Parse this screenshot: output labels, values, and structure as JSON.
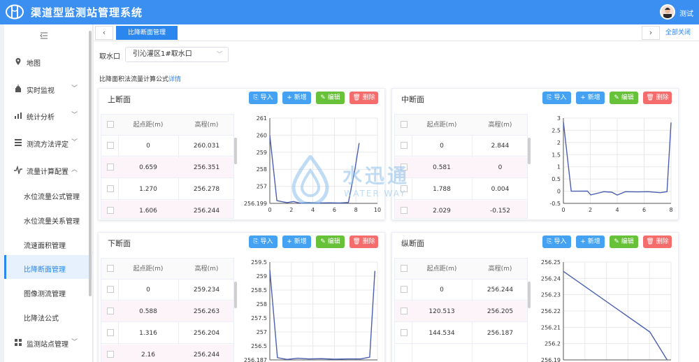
{
  "app": {
    "title": "渠道型监测站管理系统",
    "user": "测试"
  },
  "sidebar": {
    "items": [
      {
        "label": "地图",
        "icon": "map-pin-icon",
        "expandable": false
      },
      {
        "label": "实时监视",
        "icon": "alarm-icon",
        "expandable": true
      },
      {
        "label": "统计分析",
        "icon": "bar-chart-icon",
        "expandable": true
      },
      {
        "label": "测流方法评定",
        "icon": "list-icon",
        "expandable": true
      },
      {
        "label": "流量计算配置",
        "icon": "pulse-icon",
        "expandable": true,
        "expanded": true
      },
      {
        "label": "监测站点管理",
        "icon": "grid-icon",
        "expandable": true
      }
    ],
    "subitems": [
      "水位流量公式管理",
      "水位流量关系管理",
      "流速面积管理",
      "比降断面管理",
      "图像测流管理",
      "比降法公式"
    ],
    "active_sub": "比降断面管理"
  },
  "tabs": {
    "active": "比降断面管理",
    "close_all": "全部关闭",
    "prev": "‹",
    "next": "›"
  },
  "filter": {
    "label": "取水口",
    "value": "引沁灌区1#取水口"
  },
  "formula": {
    "text": "比降面积法流量计算公式",
    "link": "详情"
  },
  "buttons": {
    "import": "导入",
    "add": "新增",
    "edit": "编辑",
    "delete": "删除"
  },
  "watermark": {
    "cn": "水迅通",
    "en": "WATER WAY"
  },
  "panels": [
    {
      "title": "上断面",
      "headers": [
        "起点距(m)",
        "高程(m)"
      ],
      "rows": [
        [
          "0",
          "260.031"
        ],
        [
          "0.659",
          "256.351"
        ],
        [
          "1.270",
          "256.278"
        ],
        [
          "1.606",
          "256.244"
        ]
      ]
    },
    {
      "title": "中断面",
      "headers": [
        "起点距(m)",
        "高程(m)"
      ],
      "rows": [
        [
          "0",
          "2.844"
        ],
        [
          "0.581",
          "0"
        ],
        [
          "1.788",
          "0.004"
        ],
        [
          "2.029",
          "-0.152"
        ]
      ]
    },
    {
      "title": "下断面",
      "headers": [
        "起点距(m)",
        "高程(m)"
      ],
      "rows": [
        [
          "0",
          "259.234"
        ],
        [
          "0.588",
          "256.263"
        ],
        [
          "1.316",
          "256.204"
        ],
        [
          "2.16",
          "256.244"
        ]
      ]
    },
    {
      "title": "纵断面",
      "headers": [
        "起点距(m)",
        "高程(m)"
      ],
      "rows": [
        [
          "0",
          "256.244"
        ],
        [
          "120.513",
          "256.205"
        ],
        [
          "144.534",
          "256.187"
        ]
      ]
    }
  ],
  "chart_data": [
    {
      "type": "line",
      "panel": "上断面",
      "ylim": [
        256.199,
        261
      ],
      "xlim": [
        0,
        10
      ],
      "yticks": [
        "261",
        "260",
        "259",
        "258",
        "257",
        "256.199"
      ],
      "xticks": [
        "0",
        "2",
        "4",
        "6",
        "8",
        "10"
      ],
      "x": [
        0,
        0.659,
        1.27,
        1.606,
        2.2,
        2.8,
        3.5,
        4.5,
        5.5,
        6.5,
        7.3,
        7.9,
        8.3
      ],
      "y": [
        260.031,
        256.351,
        256.278,
        256.244,
        256.3,
        256.21,
        256.25,
        256.22,
        256.23,
        256.22,
        256.25,
        258.1,
        259.6
      ],
      "color": "#4a5fb0"
    },
    {
      "type": "line",
      "panel": "中断面",
      "ylim": [
        -0.5,
        3
      ],
      "xlim": [
        0,
        8
      ],
      "yticks": [
        "3",
        "2.5",
        "2",
        "1.5",
        "1",
        "0.5",
        "0",
        "-0.5"
      ],
      "xticks": [
        "0",
        "2",
        "4",
        "6",
        "8"
      ],
      "x": [
        0,
        0.581,
        1.788,
        2.029,
        3.0,
        3.6,
        4.0,
        4.6,
        5.5,
        6.3,
        7.2,
        7.7,
        8.0
      ],
      "y": [
        2.844,
        0,
        0.004,
        -0.152,
        -0.02,
        -0.04,
        -0.16,
        -0.02,
        -0.03,
        -0.02,
        -0.06,
        -0.02,
        2.82
      ],
      "color": "#4a5fb0"
    },
    {
      "type": "line",
      "panel": "下断面",
      "ylim": [
        256.187,
        259.5
      ],
      "xlim": [
        0,
        8.3
      ],
      "yticks": [
        "259.5",
        "259",
        "258.5",
        "258",
        "257.5",
        "257",
        "256.5",
        "256.187"
      ],
      "xticks": [],
      "x": [
        0,
        0.588,
        1.316,
        2.16,
        3.0,
        4.0,
        5.0,
        6.0,
        7.0,
        7.7,
        8.1
      ],
      "y": [
        259.234,
        256.263,
        256.204,
        256.244,
        256.22,
        256.23,
        256.21,
        256.22,
        256.22,
        256.28,
        259.2
      ],
      "color": "#4a5fb0"
    },
    {
      "type": "line",
      "panel": "纵断面",
      "ylim": [
        256.187,
        256.25
      ],
      "xlim": [
        0,
        150
      ],
      "yticks": [
        "256.25",
        "256.24",
        "256.23",
        "256.22",
        "256.21",
        "256.2",
        "256.19"
      ],
      "xticks": [],
      "x": [
        0,
        120.513,
        144.534
      ],
      "y": [
        256.244,
        256.205,
        256.187
      ],
      "color": "#4a5fb0"
    }
  ]
}
